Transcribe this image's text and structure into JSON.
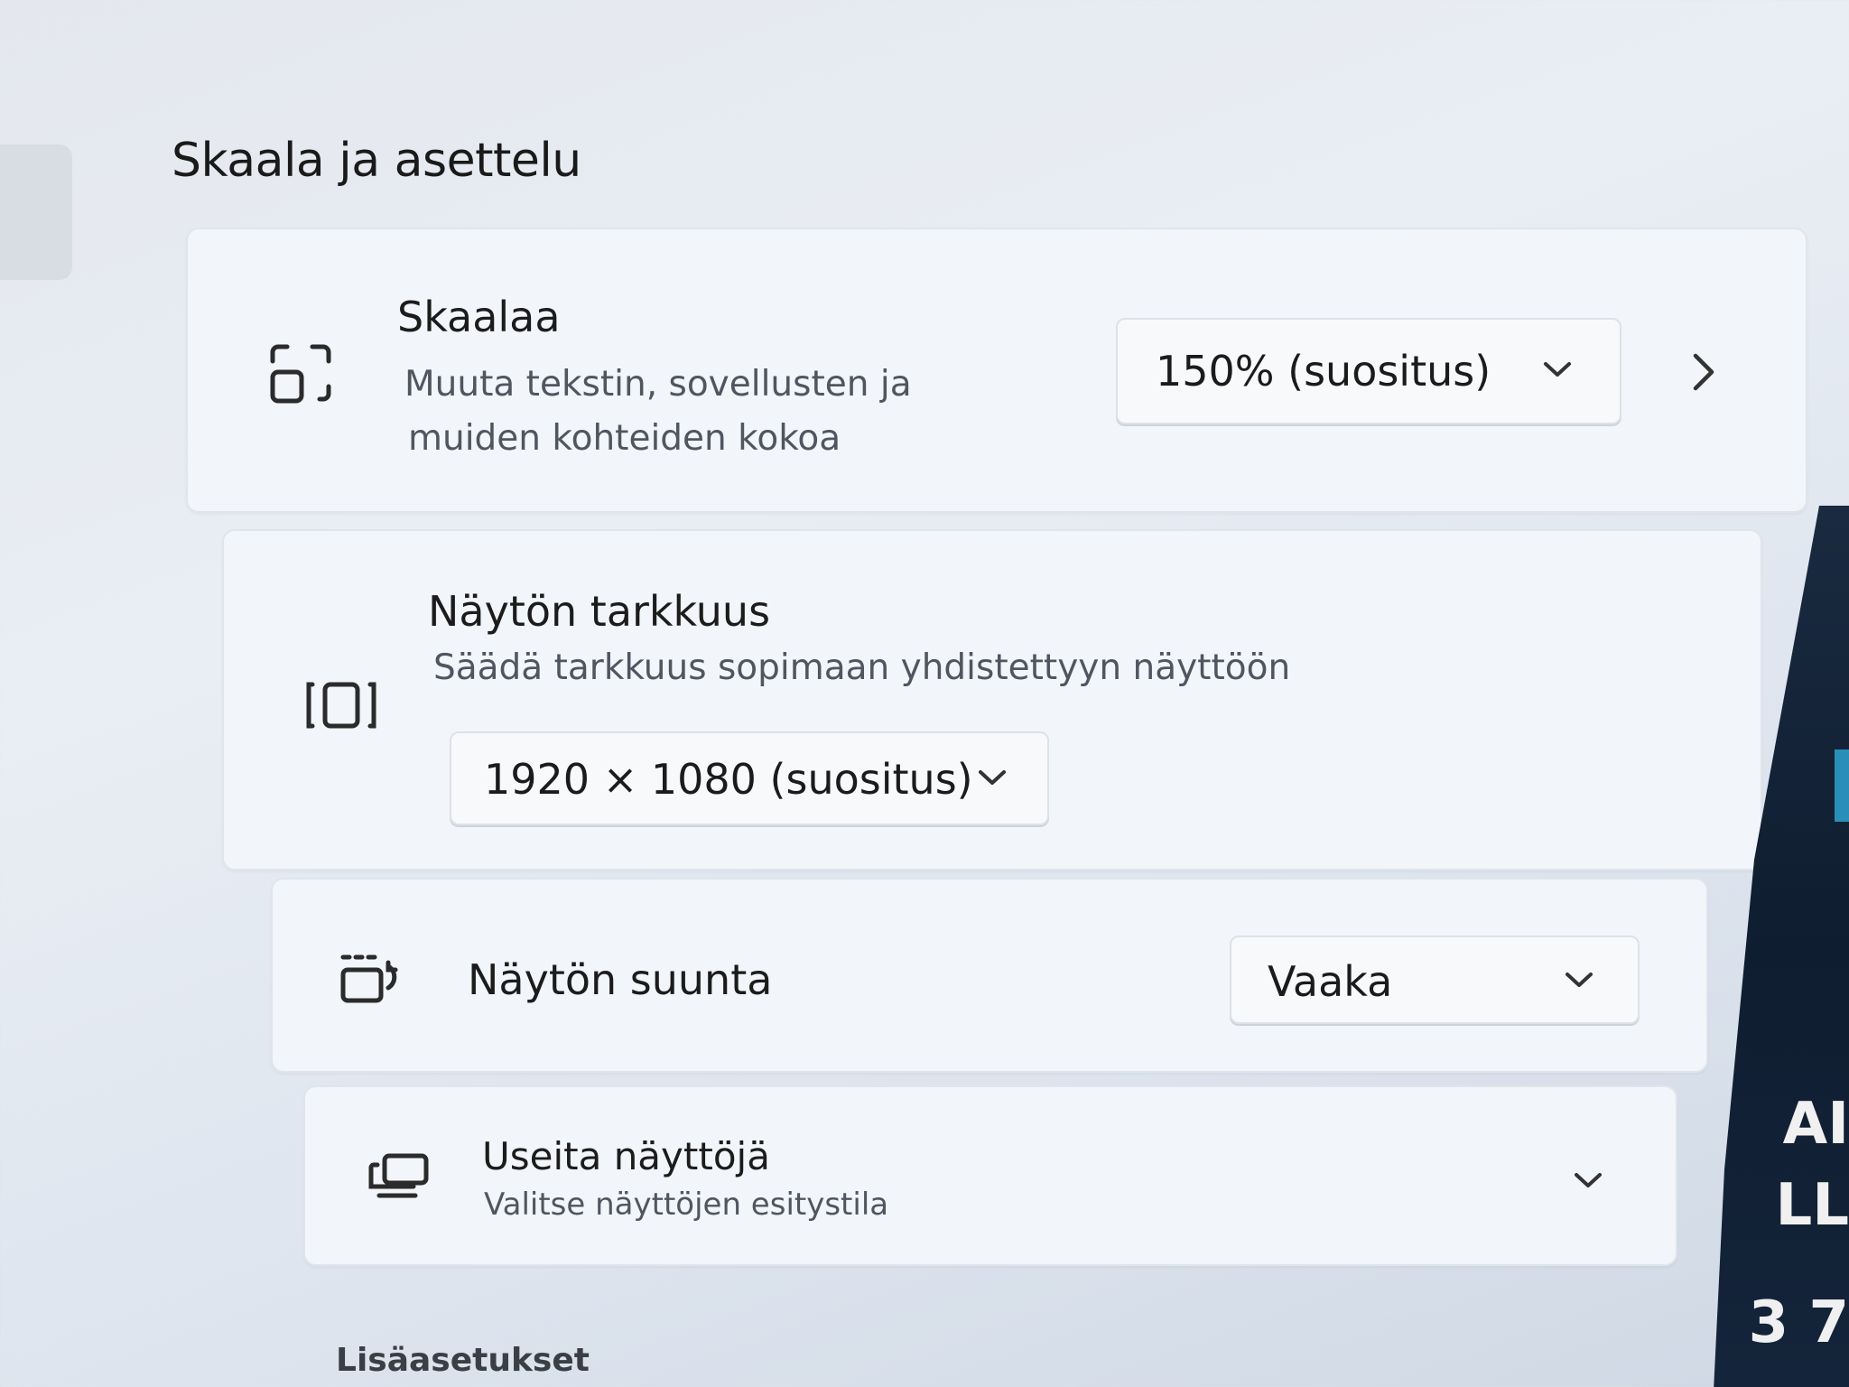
{
  "section": {
    "title": "Skaala ja asettelu"
  },
  "scale": {
    "title": "Skaalaa",
    "subtitle_line1": "Muuta tekstin, sovellusten ja",
    "subtitle_line2": "muiden kohteiden kokoa",
    "dropdown_value": "150% (suositus)",
    "icon": "scale-icon"
  },
  "resolution": {
    "title": "Näytön tarkkuus",
    "subtitle": "Säädä tarkkuus sopimaan yhdistettyyn näyttöön",
    "dropdown_value": "1920 × 1080 (suositus)",
    "icon": "resolution-icon"
  },
  "orientation": {
    "title": "Näytön suunta",
    "dropdown_value": "Vaaka",
    "icon": "orientation-icon"
  },
  "multiple_displays": {
    "title": "Useita näyttöjä",
    "subtitle": "Valitse näyttöjen esitystila",
    "icon": "multiple-displays-icon"
  },
  "more": {
    "label": "Lisäasetukset"
  },
  "background_text": {
    "line1": "AI",
    "line2": "LL",
    "line3": "3 7"
  }
}
